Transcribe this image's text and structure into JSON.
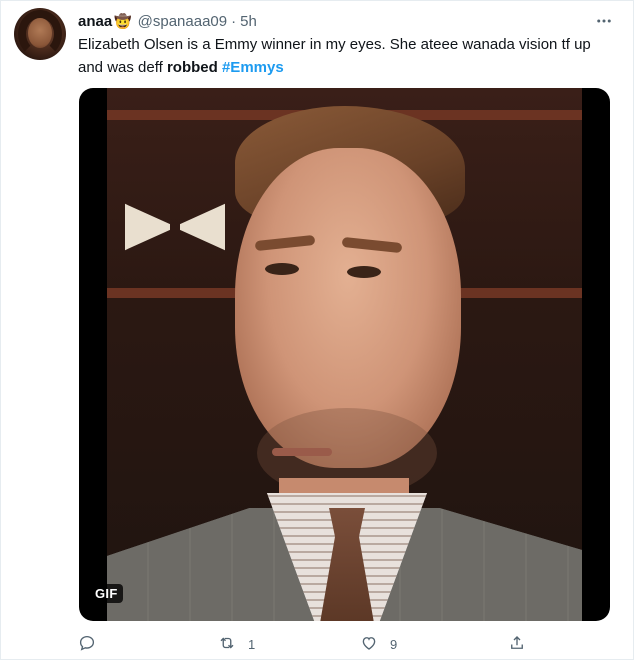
{
  "author": {
    "name": "anaa",
    "emoji": "🤠",
    "handle": "@spanaaa09",
    "separator": "·",
    "time": "5h"
  },
  "tweet": {
    "text_part1": "Elizabeth Olsen is a Emmy winner in my eyes. She ateee wanada vision tf up and was deff ",
    "bold_word": "robbed",
    "hashtag": "#Emmys"
  },
  "media": {
    "badge": "GIF"
  },
  "actions": {
    "reply_count": "",
    "retweet_count": "1",
    "like_count": "9"
  },
  "colors": {
    "accent": "#1d9bf0",
    "muted": "#536471",
    "text": "#0f1419"
  },
  "icons": [
    "more-icon",
    "reply-icon",
    "retweet-icon",
    "like-icon",
    "share-icon"
  ]
}
